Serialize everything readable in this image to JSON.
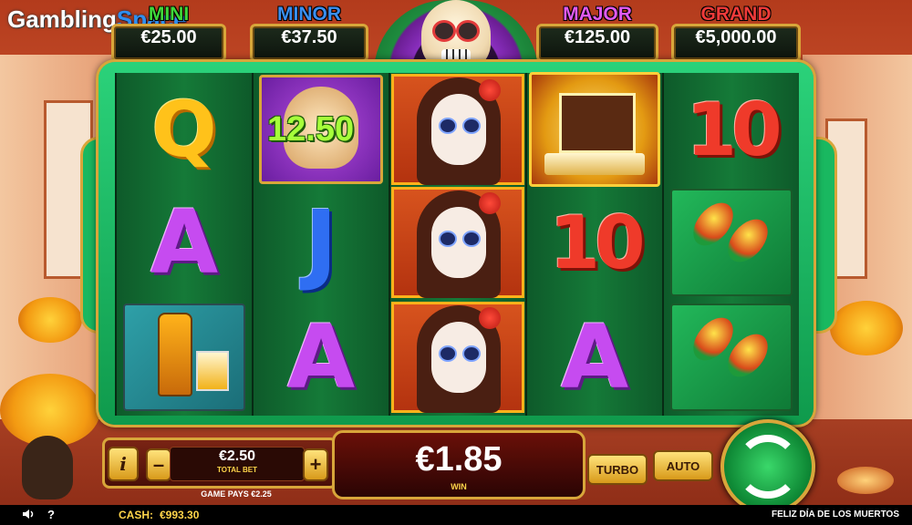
{
  "brand": {
    "part1": "Gambling",
    "part2": "Space"
  },
  "jackpots": [
    {
      "label": "MINI",
      "value": "€25.00",
      "color": "#3fd83a"
    },
    {
      "label": "MINOR",
      "value": "€37.50",
      "color": "#3a8ff0"
    },
    {
      "label": "MAJOR",
      "value": "€125.00",
      "color": "#e05af0"
    },
    {
      "label": "GRAND",
      "value": "€5,000.00",
      "color": "#f03a3a"
    }
  ],
  "reels": [
    [
      "Q",
      "A",
      "tequila"
    ],
    [
      "skull-bonus",
      "J",
      "A"
    ],
    [
      "catrina",
      "catrina",
      "catrina"
    ],
    [
      "altar",
      "10",
      "A"
    ],
    [
      "10",
      "maracas",
      "maracas"
    ]
  ],
  "bonus_value": "12.50",
  "controls": {
    "info": "i",
    "minus": "–",
    "plus": "+",
    "bet_value": "€2.50",
    "bet_label": "TOTAL BET",
    "game_pays": "GAME PAYS €2.25",
    "win_value": "€1.85",
    "win_label": "WIN",
    "turbo": "TURBO",
    "auto": "AUTO"
  },
  "status_bar": {
    "help": "?",
    "cash_label": "CASH:",
    "cash_value": "€993.30",
    "game_title": "FELIZ DÍA DE LOS MUERTOS"
  },
  "icons": [
    "speaker-icon",
    "help-icon",
    "spin-icon",
    "info-icon"
  ]
}
